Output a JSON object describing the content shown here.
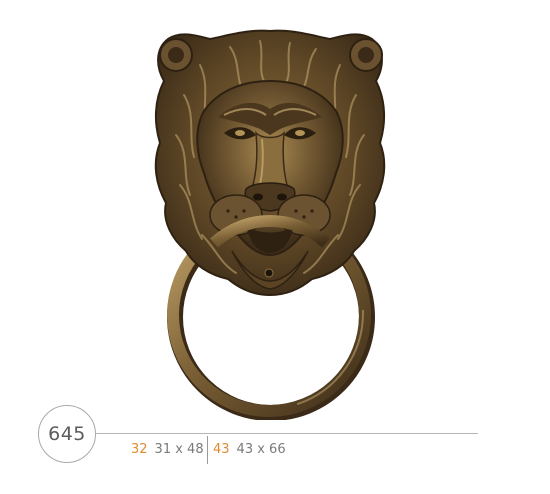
{
  "product": {
    "code": "645",
    "image_alt": "lion-head-ring-pull",
    "colors": {
      "bronze_dark": "#3a2a17",
      "bronze_mid": "#6e5530",
      "bronze_light": "#b89a62",
      "accent_orange": "#e08a32"
    }
  },
  "sizes": [
    {
      "code": "32",
      "dimensions": "31 x 48"
    },
    {
      "code": "43",
      "dimensions": "43 x 66"
    }
  ]
}
